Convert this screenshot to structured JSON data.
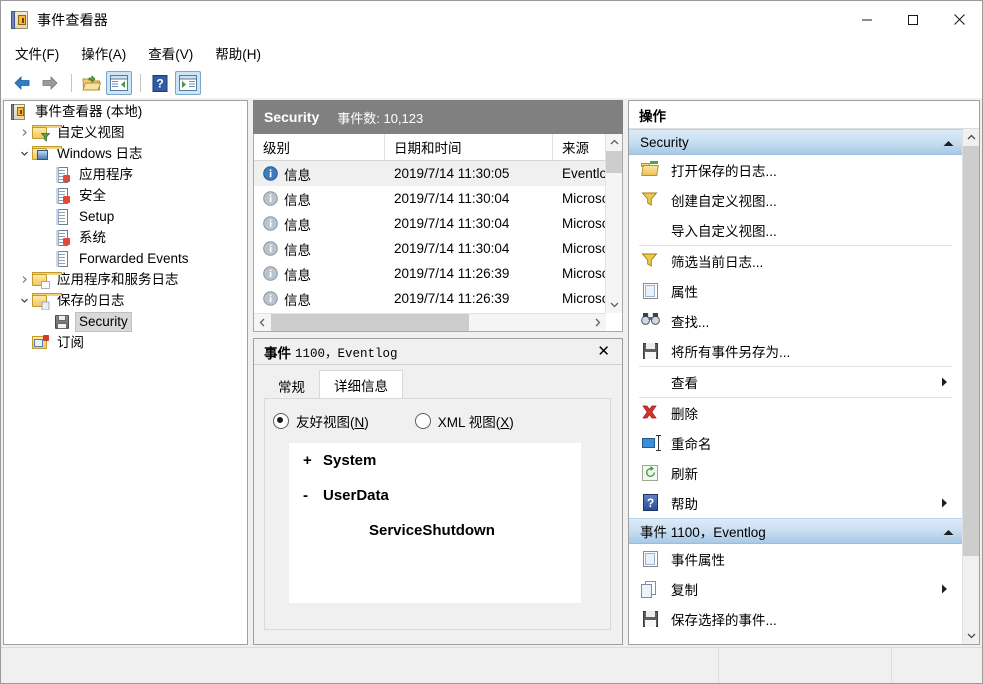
{
  "window": {
    "title": "事件查看器",
    "icon": "event-viewer-icon",
    "controls": {
      "minimize": "—",
      "maximize": "□",
      "close": "✕"
    }
  },
  "menu": {
    "items": [
      {
        "label": "文件(F)",
        "name": "menu-file"
      },
      {
        "label": "操作(A)",
        "name": "menu-action"
      },
      {
        "label": "查看(V)",
        "name": "menu-view"
      },
      {
        "label": "帮助(H)",
        "name": "menu-help"
      }
    ]
  },
  "toolbar": {
    "buttons": [
      {
        "name": "back-icon",
        "title": "后退"
      },
      {
        "name": "forward-icon",
        "title": "前进"
      },
      {
        "name": "open-saved-log-icon",
        "title": "打开保存的日志"
      },
      {
        "name": "show-hide-console-tree-icon",
        "title": "显示/隐藏控制台树",
        "active": true
      },
      {
        "name": "help-icon",
        "title": "帮助"
      },
      {
        "name": "show-hide-action-pane-icon",
        "title": "显示/隐藏操作窗格",
        "active": true
      }
    ]
  },
  "tree": {
    "items": [
      {
        "label": "事件查看器 (本地)",
        "indent": 0,
        "twisty": "",
        "icon": "event-viewer-icon",
        "selected": false
      },
      {
        "label": "自定义视图",
        "indent": 1,
        "twisty": "collapsed",
        "icon": "custom-views-folder-icon",
        "selected": false
      },
      {
        "label": "Windows 日志",
        "indent": 1,
        "twisty": "expanded",
        "icon": "windows-logs-folder-icon",
        "selected": false
      },
      {
        "label": "应用程序",
        "indent": 2,
        "twisty": "",
        "icon": "log-warning-icon",
        "selected": false
      },
      {
        "label": "安全",
        "indent": 2,
        "twisty": "",
        "icon": "log-warning-icon",
        "selected": false
      },
      {
        "label": "Setup",
        "indent": 2,
        "twisty": "",
        "icon": "log-icon",
        "selected": false
      },
      {
        "label": "系统",
        "indent": 2,
        "twisty": "",
        "icon": "log-warning-icon",
        "selected": false
      },
      {
        "label": "Forwarded Events",
        "indent": 2,
        "twisty": "",
        "icon": "log-icon",
        "selected": false
      },
      {
        "label": "应用程序和服务日志",
        "indent": 1,
        "twisty": "collapsed",
        "icon": "app-services-folder-icon",
        "selected": false
      },
      {
        "label": "保存的日志",
        "indent": 1,
        "twisty": "expanded",
        "icon": "saved-logs-folder-icon",
        "selected": false
      },
      {
        "label": "Security",
        "indent": 2,
        "twisty": "",
        "icon": "saved-log-disk-icon",
        "selected": true
      },
      {
        "label": "订阅",
        "indent": 1,
        "twisty": "",
        "icon": "subscriptions-icon",
        "selected": false
      }
    ]
  },
  "log": {
    "header": {
      "name": "Security",
      "count_label": "事件数: 10,123"
    },
    "columns": [
      {
        "label": "级别",
        "name": "column-level"
      },
      {
        "label": "日期和时间",
        "name": "column-date-time"
      },
      {
        "label": "来源",
        "name": "column-source"
      }
    ],
    "rows": [
      {
        "level": "信息",
        "datetime": "2019/7/14 11:30:05",
        "source": "Eventlog",
        "selected": true
      },
      {
        "level": "信息",
        "datetime": "2019/7/14 11:30:04",
        "source": "Microsoft Windows security auditing.",
        "selected": false
      },
      {
        "level": "信息",
        "datetime": "2019/7/14 11:30:04",
        "source": "Microsoft Windows security auditing.",
        "selected": false
      },
      {
        "level": "信息",
        "datetime": "2019/7/14 11:30:04",
        "source": "Microsoft Windows security auditing.",
        "selected": false
      },
      {
        "level": "信息",
        "datetime": "2019/7/14 11:26:39",
        "source": "Microsoft Windows security auditing.",
        "selected": false
      },
      {
        "level": "信息",
        "datetime": "2019/7/14 11:26:39",
        "source": "Microsoft Windows security auditing.",
        "selected": false
      }
    ]
  },
  "detail": {
    "title_prefix": "事件",
    "title_suffix": "1100，Eventlog",
    "close_label": "✕",
    "tabs": [
      {
        "label": "常规",
        "name": "tab-general",
        "active": false
      },
      {
        "label": "详细信息",
        "name": "tab-details",
        "active": true
      }
    ],
    "view_modes": [
      {
        "label": "友好视图(",
        "accel": "N",
        "tail": ")",
        "selected": true,
        "name": "radio-friendly-view"
      },
      {
        "label": "XML 视图(",
        "accel": "X",
        "tail": ")",
        "selected": false,
        "name": "radio-xml-view"
      }
    ],
    "xml_tree": [
      {
        "sign": "+",
        "label": "System"
      },
      {
        "sign": "-",
        "label": "UserData"
      }
    ],
    "xml_leaf": "ServiceShutdown"
  },
  "actions": {
    "title": "操作",
    "groups": [
      {
        "header": "Security",
        "name": "action-group-security",
        "caret": "▲",
        "items": [
          {
            "label": "打开保存的日志...",
            "icon": "open-saved-log-icon",
            "submenu": false,
            "sep_after": false
          },
          {
            "label": "创建自定义视图...",
            "icon": "create-custom-view-icon",
            "submenu": false,
            "sep_after": false
          },
          {
            "label": "导入自定义视图...",
            "icon": "none",
            "submenu": false,
            "sep_after": true
          },
          {
            "label": "筛选当前日志...",
            "icon": "filter-icon",
            "submenu": false,
            "sep_after": false
          },
          {
            "label": "属性",
            "icon": "properties-icon",
            "submenu": false,
            "sep_after": false
          },
          {
            "label": "查找...",
            "icon": "find-icon",
            "submenu": false,
            "sep_after": false
          },
          {
            "label": "将所有事件另存为...",
            "icon": "save-icon",
            "submenu": false,
            "sep_after": true
          },
          {
            "label": "查看",
            "icon": "none",
            "submenu": true,
            "sep_after": true
          },
          {
            "label": "删除",
            "icon": "delete-icon",
            "submenu": false,
            "sep_after": false
          },
          {
            "label": "重命名",
            "icon": "rename-icon",
            "submenu": false,
            "sep_after": false
          },
          {
            "label": "刷新",
            "icon": "refresh-icon",
            "submenu": false,
            "sep_after": false
          },
          {
            "label": "帮助",
            "icon": "help-icon",
            "submenu": true,
            "sep_after": false
          }
        ]
      },
      {
        "header": "事件 1100，Eventlog",
        "name": "action-group-event",
        "caret": "▲",
        "items": [
          {
            "label": "事件属性",
            "icon": "properties-icon",
            "submenu": false,
            "sep_after": false
          },
          {
            "label": "复制",
            "icon": "copy-icon",
            "submenu": true,
            "sep_after": false
          },
          {
            "label": "保存选择的事件...",
            "icon": "save-icon",
            "submenu": false,
            "sep_after": false
          }
        ]
      }
    ]
  },
  "colors": {
    "log_header_bg": "#808080",
    "group_header_blue": "#a8c9e6",
    "selection_gray": "#d8d8d8",
    "window_bg": "#ffffff",
    "chrome_bg": "#f0f0f0"
  }
}
